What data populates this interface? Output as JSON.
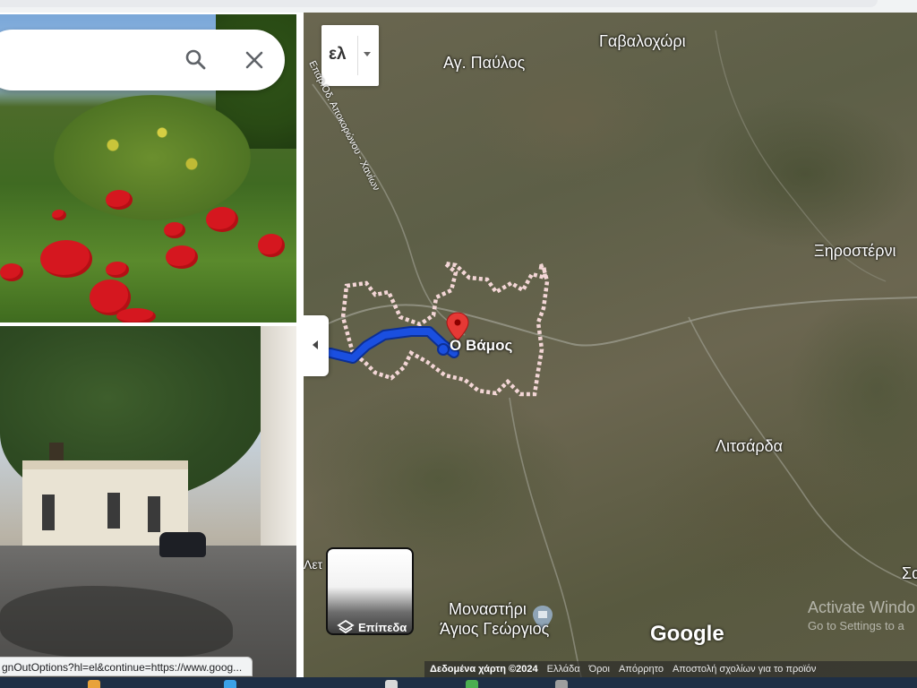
{
  "search": {
    "search_icon": "search-icon",
    "close_icon": "close-icon"
  },
  "map": {
    "language_button": "ελ",
    "place_labels": {
      "gavalochori": "Γαβαλοχώρι",
      "ag_pavlos": "Αγ. Παύλος",
      "xirosterni": "Ξηροστέρνι",
      "vamos": "Ο Βάμος",
      "litsarda": "Λιτσάρδα",
      "monastery_line1": "Μοναστήρι",
      "monastery_line2": "Άγιος Γεώργιος",
      "left_edge": "Λετ",
      "right_edge": "Σα"
    },
    "road_label": "Επαρ.Οδ. Αποκορώνου - Χανίων",
    "layers_label": "Επίπεδα",
    "google_logo": "Google",
    "footer": {
      "map_data": "Δεδομένα χάρτη ©2024",
      "greece": "Ελλάδα",
      "terms": "Όροι",
      "privacy": "Απόρρητο",
      "feedback": "Αποστολή σχολίων για το προϊόν"
    },
    "watermark": {
      "line1": "Activate Windo",
      "line2": "Go to Settings to a"
    },
    "colors": {
      "route": "#1a4fe0",
      "boundary": "#f3d6d6",
      "pin": "#e53935"
    }
  },
  "status_url": "gnOutOptions?hl=el&continue=https://www.goog..."
}
